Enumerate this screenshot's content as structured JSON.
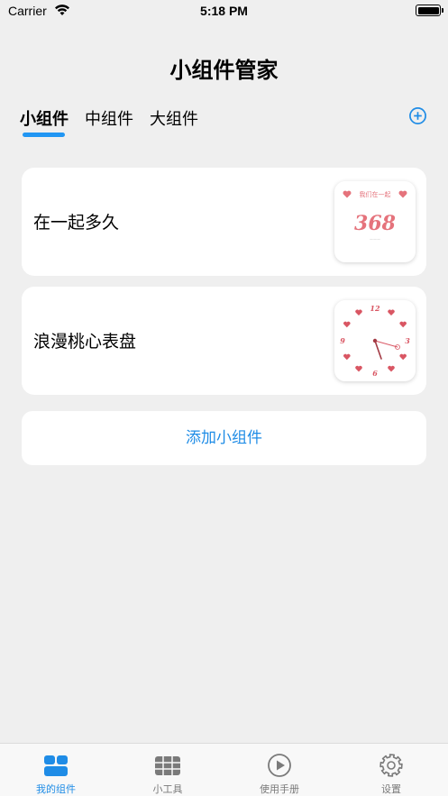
{
  "status_bar": {
    "carrier": "Carrier",
    "time": "5:18 PM"
  },
  "header": {
    "title": "小组件管家"
  },
  "size_tabs": [
    {
      "label": "小组件",
      "active": true
    },
    {
      "label": "中组件",
      "active": false
    },
    {
      "label": "大组件",
      "active": false
    }
  ],
  "widgets": [
    {
      "label": "在一起多久",
      "preview": {
        "header": "我们在一起",
        "days": "368"
      }
    },
    {
      "label": "浪漫桃心表盘",
      "preview": {
        "numbers": [
          "12",
          "3",
          "6",
          "9"
        ]
      }
    }
  ],
  "add_widget_label": "添加小组件",
  "bottom_tabs": [
    {
      "label": "我的组件",
      "icon": "widgets-grid-icon",
      "active": true
    },
    {
      "label": "小工具",
      "icon": "table-icon",
      "active": false
    },
    {
      "label": "使用手册",
      "icon": "play-circle-icon",
      "active": false
    },
    {
      "label": "设置",
      "icon": "gear-icon",
      "active": false
    }
  ],
  "colors": {
    "accent": "#1f8ce6",
    "tab_underline": "#2196f3",
    "heart_pink": "#e5737c",
    "clock_heart": "#d95663"
  }
}
